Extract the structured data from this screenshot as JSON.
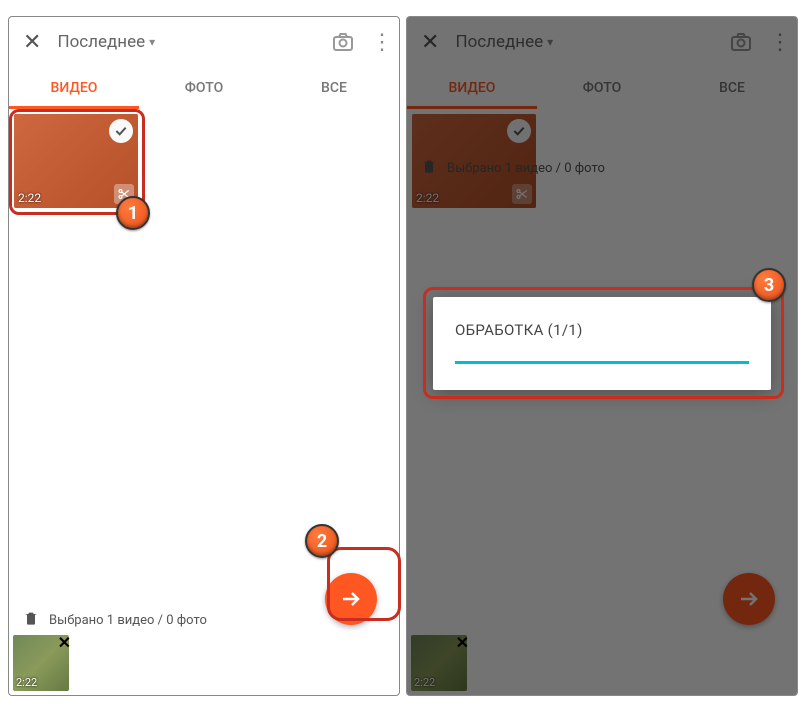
{
  "topbar": {
    "dropdown_label": "Последнее"
  },
  "tabs": {
    "video": "ВИДЕО",
    "photo": "ФОТО",
    "all": "ВСЕ"
  },
  "thumb": {
    "duration": "2:22"
  },
  "selection": {
    "text": "Выбрано 1 видео / 0 фото"
  },
  "mini": {
    "duration": "2:22"
  },
  "dialog": {
    "title": "ОБРАБОТКА (1/1)"
  },
  "callouts": {
    "one": "1",
    "two": "2",
    "three": "3"
  }
}
